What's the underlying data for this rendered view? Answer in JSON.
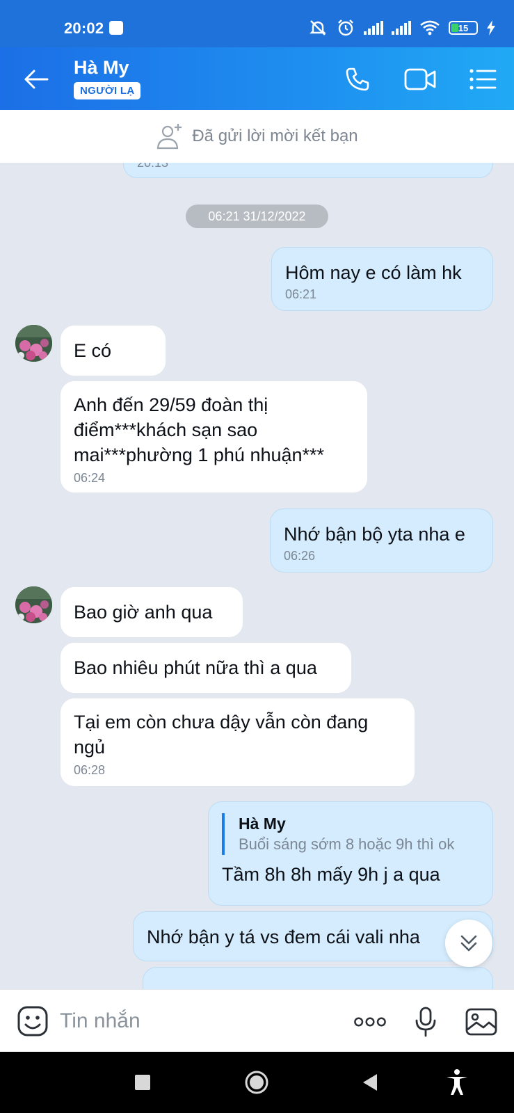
{
  "status_bar": {
    "time": "20:02",
    "battery": "15"
  },
  "header": {
    "contact_name": "Hà My",
    "badge": "NGƯỜI LẠ",
    "icons": [
      "back-arrow-icon",
      "phone-icon",
      "video-call-icon",
      "menu-list-icon"
    ]
  },
  "friend_banner": {
    "text": "Đã gửi lời mời kết bạn"
  },
  "chat": {
    "partial_top_time": "20:13",
    "date_separator": "06:21 31/12/2022",
    "messages": [
      {
        "dir": "out",
        "text": "Hôm nay e có làm hk",
        "time": "06:21"
      },
      {
        "dir": "in",
        "text": "E có",
        "time": ""
      },
      {
        "dir": "in",
        "text_lines": [
          "Anh đến 29/59 đoàn thị",
          "điểm***khách sạn sao",
          "mai***phường 1 phú nhuận***"
        ],
        "time": "06:24"
      },
      {
        "dir": "out",
        "text": "Nhớ bận bộ yta nha e",
        "time": "06:26"
      },
      {
        "dir": "in",
        "text": "Bao giờ anh qua",
        "time": ""
      },
      {
        "dir": "in",
        "text": "Bao nhiêu phút nữa thì a qua",
        "time": ""
      },
      {
        "dir": "in",
        "text_lines": [
          "Tại em còn chưa dậy vẫn còn đang",
          "ngủ"
        ],
        "time": "06:28"
      },
      {
        "dir": "out",
        "quote": {
          "name": "Hà My",
          "text": "Buổi sáng sớm 8 hoặc 9h thì ok"
        },
        "text": "Tầm 8h 8h mấy 9h j a qua",
        "time": ""
      },
      {
        "dir": "out",
        "text": "Nhớ bận y tá vs đem cái vali nha",
        "time": ""
      }
    ]
  },
  "input_bar": {
    "placeholder": "Tin nhắn"
  },
  "colors": {
    "header_start": "#1c6fe6",
    "header_end": "#21a9f5",
    "outgoing_bubble": "#d4ecfd",
    "incoming_bubble": "#ffffff",
    "chat_background": "#e3e8f0"
  }
}
